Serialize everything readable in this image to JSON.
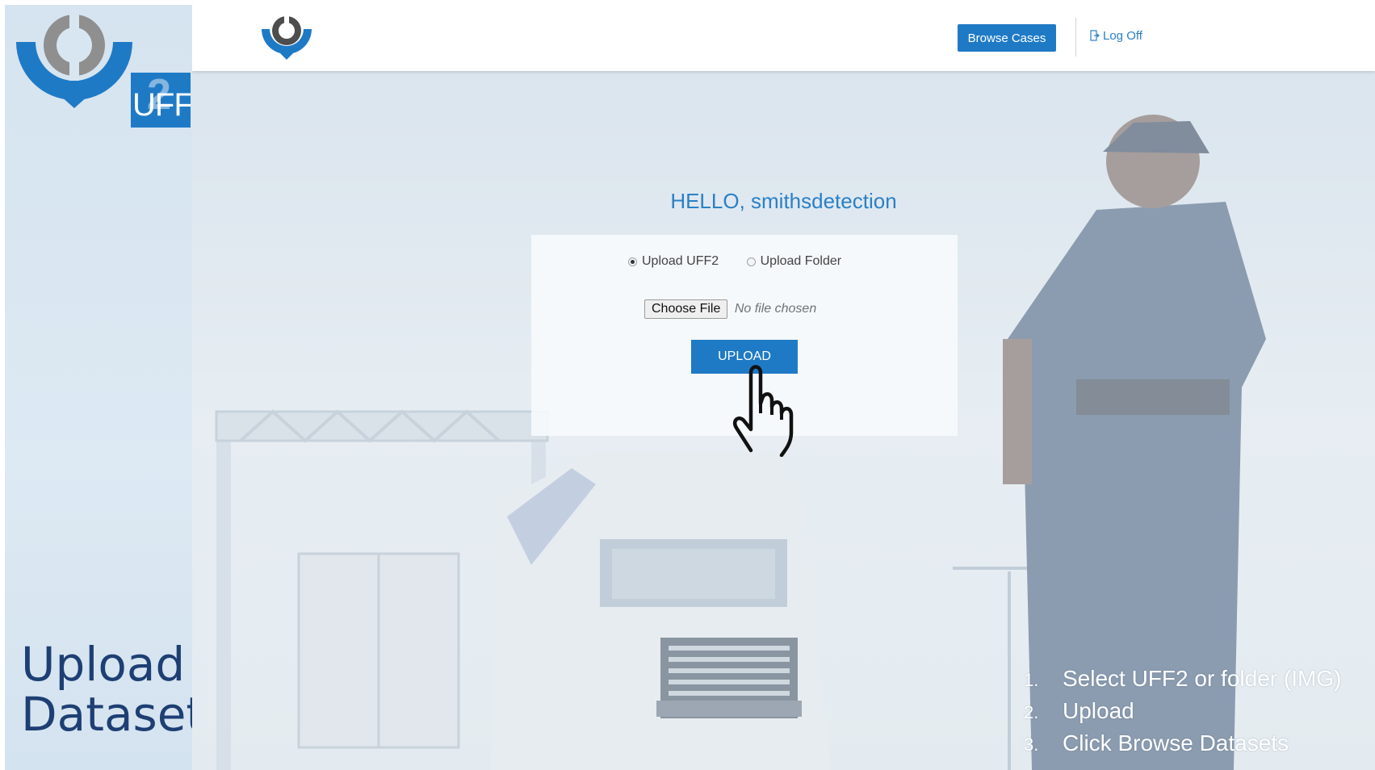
{
  "sidebar": {
    "badge": {
      "text": "UFF",
      "overlay": "2"
    },
    "title_lines": [
      "Upload",
      "Dataset"
    ]
  },
  "topbar": {
    "browse_label": "Browse Cases",
    "logoff_label": "Log Off"
  },
  "main": {
    "greeting": "HELLO, smithsdetection",
    "radio_options": [
      "Upload UFF2",
      "Upload Folder"
    ],
    "radio_selected": "Upload UFF2",
    "choose_file_label": "Choose File",
    "file_status": "No file chosen",
    "upload_label": "UPLOAD"
  },
  "steps": [
    {
      "num": "1.",
      "text": "Select UFF2 or folder (IMG)"
    },
    {
      "num": "2.",
      "text": "Upload"
    },
    {
      "num": "3.",
      "text": "Click Browse Datasets"
    }
  ],
  "colors": {
    "accent": "#1f7ac6",
    "title": "#1e3f73",
    "logo_gray": "#8c8c8c"
  },
  "icons": [
    "wco-logo-icon",
    "log-off-icon",
    "pointer-hand-icon"
  ]
}
